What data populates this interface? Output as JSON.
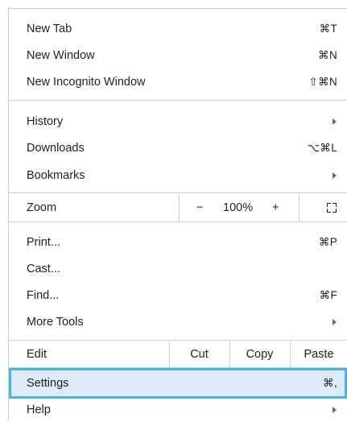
{
  "menu": {
    "group1": [
      {
        "label": "New Tab",
        "shortcut": "⌘T"
      },
      {
        "label": "New Window",
        "shortcut": "⌘N"
      },
      {
        "label": "New Incognito Window",
        "shortcut": "⇧⌘N"
      }
    ],
    "group2": [
      {
        "label": "History",
        "submenu": true
      },
      {
        "label": "Downloads",
        "shortcut": "⌥⌘L"
      },
      {
        "label": "Bookmarks",
        "submenu": true
      }
    ],
    "zoom": {
      "label": "Zoom",
      "minus": "−",
      "level": "100%",
      "plus": "+",
      "fullscreen_icon": "fullscreen-icon"
    },
    "group3": [
      {
        "label": "Print...",
        "shortcut": "⌘P"
      },
      {
        "label": "Cast..."
      },
      {
        "label": "Find...",
        "shortcut": "⌘F"
      },
      {
        "label": "More Tools",
        "submenu": true
      }
    ],
    "edit": {
      "label": "Edit",
      "cut": "Cut",
      "copy": "Copy",
      "paste": "Paste"
    },
    "settings": {
      "label": "Settings",
      "shortcut": "⌘,"
    },
    "help": {
      "label": "Help",
      "submenu": true
    }
  },
  "colors": {
    "highlight_bg": "#dcebf7",
    "highlight_border": "#4ab4e0",
    "separator": "#d0d0d0"
  }
}
